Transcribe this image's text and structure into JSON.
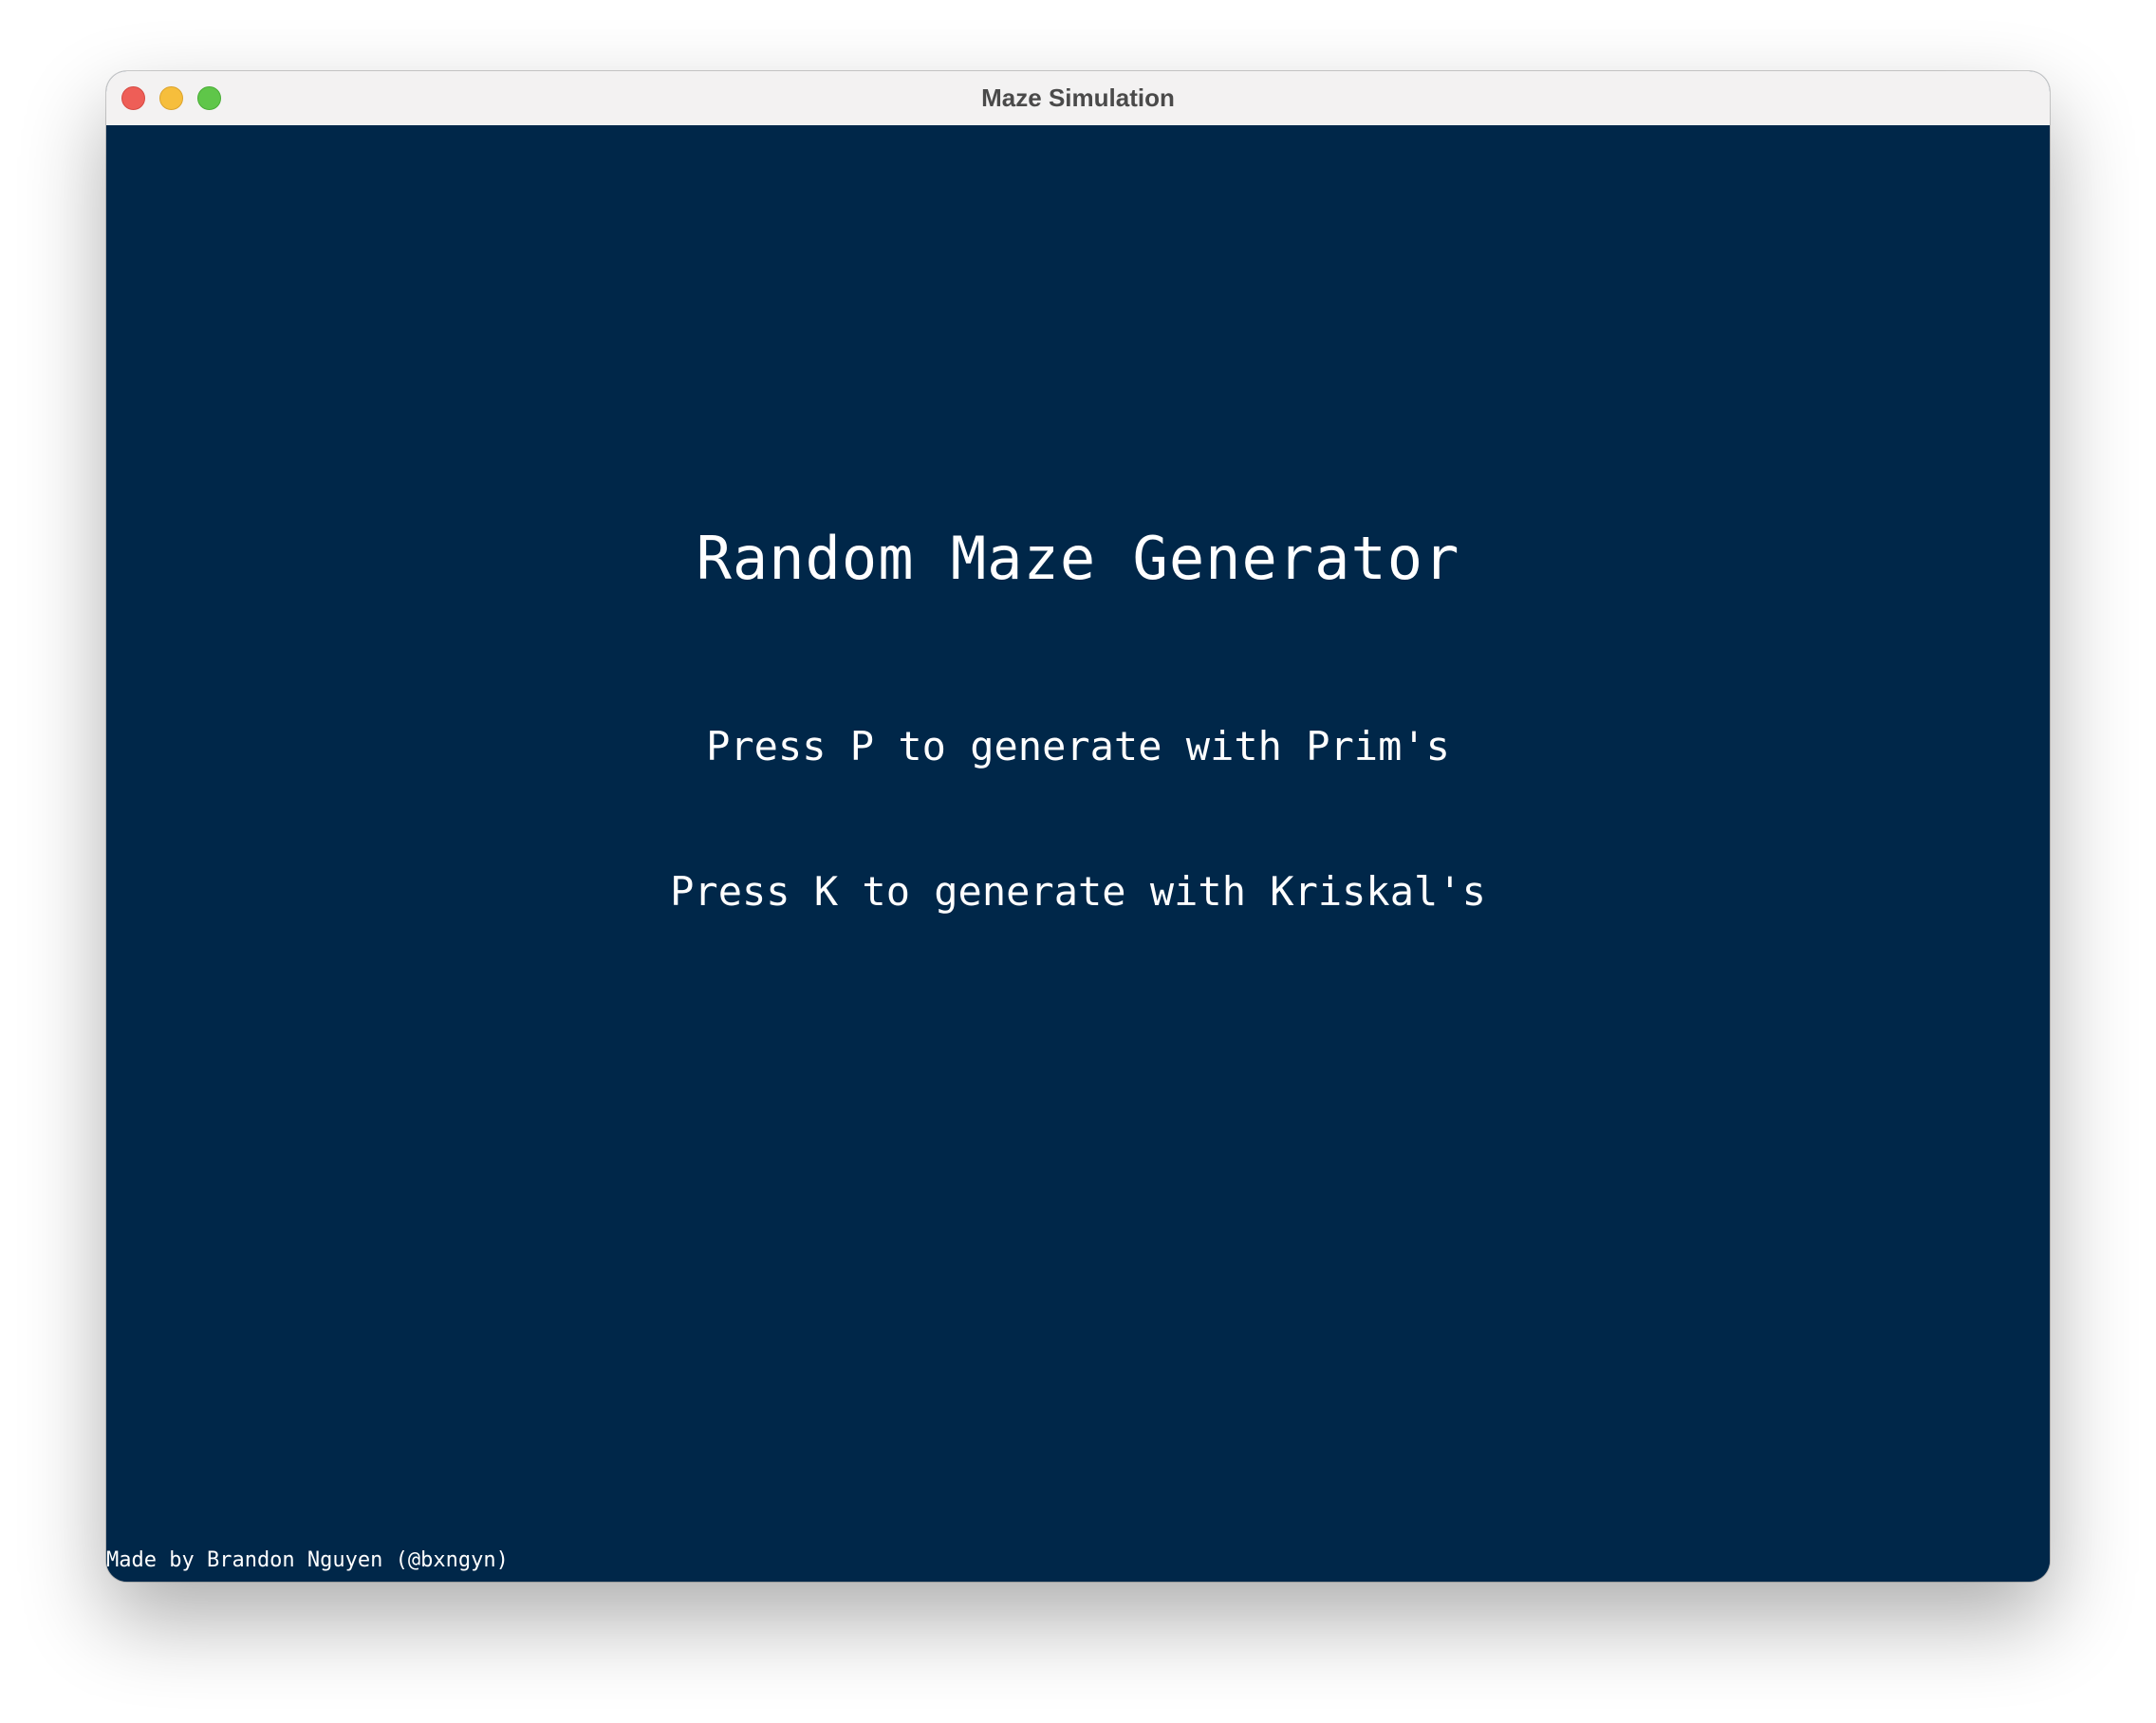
{
  "window": {
    "title": "Maze Simulation",
    "background_color": "#002749",
    "titlebar_color": "#f3f2f2",
    "traffic_lights": [
      {
        "name": "close",
        "color": "#ee5e57"
      },
      {
        "name": "minimize",
        "color": "#f6be3c"
      },
      {
        "name": "zoom",
        "color": "#5fc649"
      }
    ]
  },
  "menu": {
    "title": "Random Maze Generator",
    "options": [
      {
        "label": "Press P to generate with Prim's"
      },
      {
        "label": "Press K to generate with Kriskal's"
      }
    ]
  },
  "footer": {
    "credit": "Made by Brandon Nguyen (@bxngyn)"
  },
  "text_color": "#ffffff"
}
